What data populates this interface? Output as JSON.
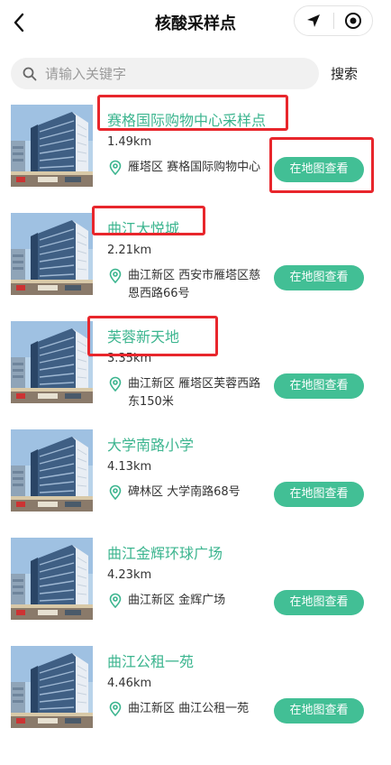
{
  "header": {
    "title": "核酸采样点",
    "back_icon": "chevron-left-icon",
    "capsule_icons": [
      "location-arrow-icon",
      "target-circle-icon"
    ]
  },
  "search": {
    "placeholder": "请输入关键字",
    "value": "",
    "button_label": "搜索"
  },
  "colors": {
    "accent": "#42bf95",
    "name_text": "#3cb58f",
    "highlight_red": "#e8262c"
  },
  "sites": [
    {
      "name": "赛格国际购物中心采样点",
      "distance": "1.49km",
      "address": "雁塔区 赛格国际购物中心",
      "button": "在地图查看"
    },
    {
      "name": "曲江大悦城",
      "distance": "2.21km",
      "address": "曲江新区 西安市雁塔区慈恩西路66号",
      "button": "在地图查看"
    },
    {
      "name": "芙蓉新天地",
      "distance": "3.35km",
      "address": "曲江新区 雁塔区芙蓉西路东150米",
      "button": "在地图查看"
    },
    {
      "name": "大学南路小学",
      "distance": "4.13km",
      "address": "碑林区 大学南路68号",
      "button": "在地图查看"
    },
    {
      "name": "曲江金辉环球广场",
      "distance": "4.23km",
      "address": "曲江新区 金辉广场",
      "button": "在地图查看"
    },
    {
      "name": "曲江公租一苑",
      "distance": "4.46km",
      "address": "曲江新区 曲江公租一苑",
      "button": "在地图查看"
    }
  ]
}
